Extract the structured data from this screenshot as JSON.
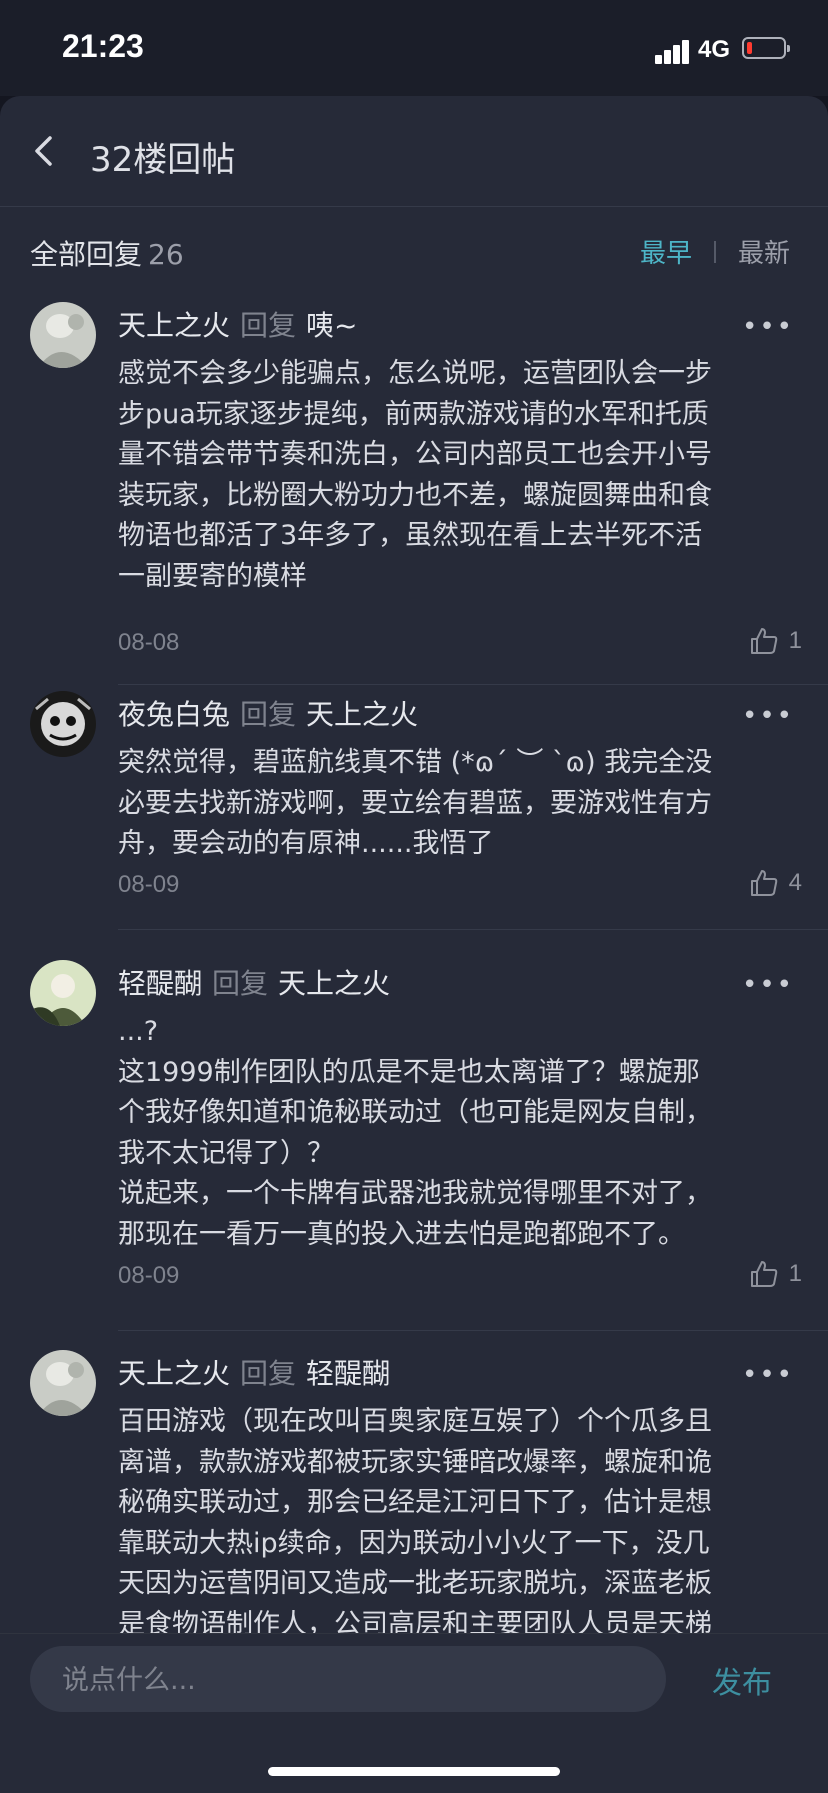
{
  "status_bar": {
    "time": "21:23",
    "network": "4G",
    "battery_level": 0.1
  },
  "header": {
    "title": "32楼回帖"
  },
  "replies": {
    "label": "全部回复",
    "count": "26",
    "sort": {
      "active": "最早",
      "inactive": "最新"
    }
  },
  "comments": [
    {
      "user": "天上之火",
      "reply_text": "回复",
      "target": "咦~",
      "lines": [
        "感觉不会多少能骗点，怎么说呢，运营团队会一步",
        "步pua玩家逐步提纯，前两款游戏请的水军和托质",
        "量不错会带节奏和洗白，公司内部员工也会开小号",
        "装玩家，比粉圈大粉功力也不差，螺旋圆舞曲和食",
        "物语也都活了3年多了，虽然现在看上去半死不活",
        "一副要寄的模样"
      ],
      "date": "08-08",
      "likes": "1"
    },
    {
      "user": "夜兔白兔",
      "reply_text": "回复",
      "target": "天上之火",
      "lines": [
        "突然觉得，碧蓝航线真不错 (*ɷ´ ︶ `ɷ) 我完全没",
        "必要去找新游戏啊，要立绘有碧蓝，要游戏性有方",
        "舟，要会动的有原神......我悟了"
      ],
      "date": "08-09",
      "likes": "4"
    },
    {
      "user": "轻醍醐",
      "reply_text": "回复",
      "target": "天上之火",
      "lines": [
        "...?",
        "这1999制作团队的瓜是不是也太离谱了？螺旋那",
        "个我好像知道和诡秘联动过（也可能是网友自制，",
        "我不太记得了）？",
        "说起来，一个卡牌有武器池我就觉得哪里不对了，",
        "那现在一看万一真的投入进去怕是跑都跑不了。"
      ],
      "date": "08-09",
      "likes": "1"
    },
    {
      "user": "天上之火",
      "reply_text": "回复",
      "target": "轻醍醐",
      "lines": [
        "百田游戏（现在改叫百奥家庭互娱了）个个瓜多且",
        "离谱，款款游戏都被玩家实锤暗改爆率，螺旋和诡",
        "秘确实联动过，那会已经是江河日下了，估计是想",
        "靠联动大热ip续命，因为联动小小火了一下，没几",
        "天因为运营阴间又造成一批老玩家脱坑，深蓝老板",
        "是食物语制作人，公司高层和主要团队人员是天梯"
      ]
    }
  ],
  "composer": {
    "placeholder": "说点什么...",
    "publish_label": "发布"
  }
}
